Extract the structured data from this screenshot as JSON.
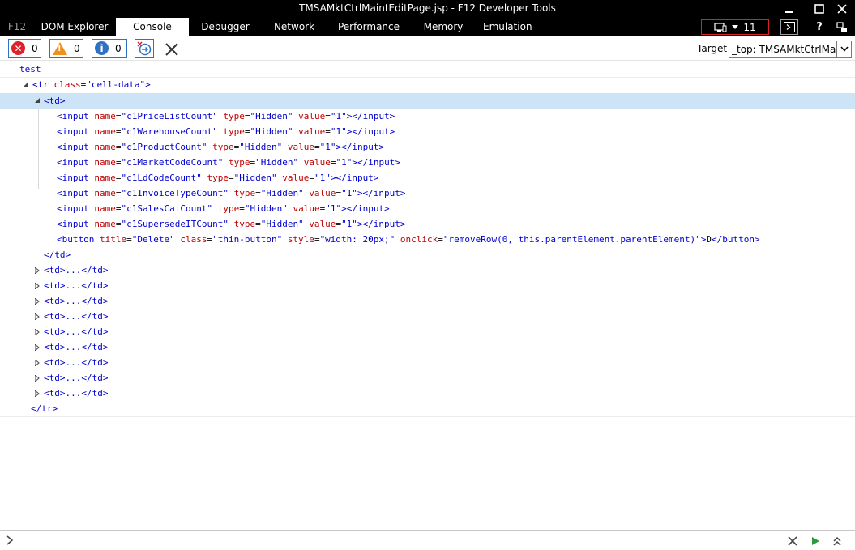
{
  "window": {
    "title": "TMSAMktCtrlMaintEditPage.jsp - F12 Developer Tools"
  },
  "tabs": {
    "f12": "F12",
    "dom_explorer": "DOM Explorer",
    "console": "Console",
    "debugger": "Debugger",
    "network": "Network",
    "performance": "Performance",
    "memory": "Memory",
    "emulation": "Emulation"
  },
  "doc_mode": {
    "value": "11"
  },
  "toolbar": {
    "errors_count": "0",
    "warnings_count": "0",
    "info_count": "0",
    "target_label": "Target",
    "target_value": "_top: TMSAMktCtrlMain"
  },
  "colors": {
    "error": "#e0202a",
    "warning": "#f0901e",
    "info": "#2f72c4",
    "tag": "#0000d0",
    "attr_name": "#c00000",
    "selection": "#cde4f7"
  },
  "output": {
    "log_text": "test",
    "tr_open": "<tr",
    "tr_class_attr": "class",
    "tr_class_val": "\"cell-data\"",
    "tr_gt": ">",
    "td_open": "<td>",
    "inputs": [
      {
        "tag": "<input",
        "name_attr": "name",
        "name_val": "\"c1PriceListCount\"",
        "type_attr": "type",
        "type_val": "\"Hidden\"",
        "value_attr": "value",
        "value_val": "\"1\"",
        "close": "></input>"
      },
      {
        "tag": "<input",
        "name_attr": "name",
        "name_val": "\"c1WarehouseCount\"",
        "type_attr": "type",
        "type_val": "\"Hidden\"",
        "value_attr": "value",
        "value_val": "\"1\"",
        "close": "></input>"
      },
      {
        "tag": "<input",
        "name_attr": "name",
        "name_val": "\"c1ProductCount\"",
        "type_attr": "type",
        "type_val": "\"Hidden\"",
        "value_attr": "value",
        "value_val": "\"1\"",
        "close": "></input>"
      },
      {
        "tag": "<input",
        "name_attr": "name",
        "name_val": "\"c1MarketCodeCount\"",
        "type_attr": "type",
        "type_val": "\"Hidden\"",
        "value_attr": "value",
        "value_val": "\"1\"",
        "close": "></input>"
      },
      {
        "tag": "<input",
        "name_attr": "name",
        "name_val": "\"c1LdCodeCount\"",
        "type_attr": "type",
        "type_val": "\"Hidden\"",
        "value_attr": "value",
        "value_val": "\"1\"",
        "close": "></input>"
      },
      {
        "tag": "<input",
        "name_attr": "name",
        "name_val": "\"c1InvoiceTypeCount\"",
        "type_attr": "type",
        "type_val": "\"Hidden\"",
        "value_attr": "value",
        "value_val": "\"1\"",
        "close": "></input>"
      },
      {
        "tag": "<input",
        "name_attr": "name",
        "name_val": "\"c1SalesCatCount\"",
        "type_attr": "type",
        "type_val": "\"Hidden\"",
        "value_attr": "value",
        "value_val": "\"1\"",
        "close": "></input>"
      },
      {
        "tag": "<input",
        "name_attr": "name",
        "name_val": "\"c1SupersedeITCount\"",
        "type_attr": "type",
        "type_val": "\"Hidden\"",
        "value_attr": "value",
        "value_val": "\"1\"",
        "close": "></input>"
      }
    ],
    "button": {
      "tag": "<button",
      "title_attr": "title",
      "title_val": "\"Delete\"",
      "class_attr": "class",
      "class_val": "\"thin-button\"",
      "style_attr": "style",
      "style_val": "\"width: 20px;\"",
      "onclick_attr": "onclick",
      "onclick_val": "\"removeRow(0, this.parentElement.parentElement)\"",
      "gt": ">",
      "text": "D",
      "close": "</button>"
    },
    "td_close": "</td>",
    "collapsed_td": "<td>...</td>",
    "tr_close": "</tr>"
  }
}
